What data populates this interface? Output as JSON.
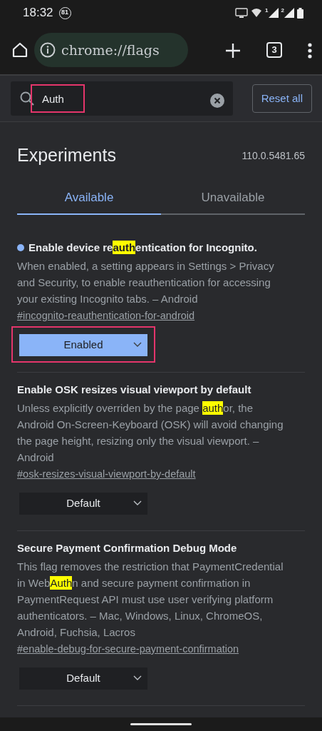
{
  "status_bar": {
    "time": "18:32",
    "notification_count": "81",
    "sim_labels": [
      "1",
      "2"
    ]
  },
  "toolbar": {
    "url": "chrome://flags",
    "tab_count": "3"
  },
  "search": {
    "value": "Auth",
    "annotated": true,
    "reset_label": "Reset all"
  },
  "header": {
    "title": "Experiments",
    "version": "110.0.5481.65"
  },
  "tabs": [
    {
      "label": "Available",
      "selected": true
    },
    {
      "label": "Unavailable",
      "selected": false
    }
  ],
  "flags": [
    {
      "modified": true,
      "annotated": true,
      "title": [
        {
          "text": "Enable device re",
          "match": false
        },
        {
          "text": "auth",
          "match": true
        },
        {
          "text": "entication for Incognito.",
          "match": false
        }
      ],
      "description": [
        {
          "text": "When enabled, a setting appears in Settings > Privacy and Security, to enable reauthentication for accessing your existing Incognito tabs. – Android",
          "match": false
        }
      ],
      "link": "#incognito-reauthentication-for-android",
      "value": "Enabled"
    },
    {
      "modified": false,
      "annotated": false,
      "title": [
        {
          "text": "Enable OSK resizes visual viewport by default",
          "match": false
        }
      ],
      "description": [
        {
          "text": "Unless explicitly overriden by the page ",
          "match": false
        },
        {
          "text": "auth",
          "match": true
        },
        {
          "text": "or, the Android On-Screen-Keyboard (OSK) will avoid changing the page height, resizing only the visual viewport. – Android",
          "match": false
        }
      ],
      "link": "#osk-resizes-visual-viewport-by-default",
      "value": "Default"
    },
    {
      "modified": false,
      "annotated": false,
      "title": [
        {
          "text": "Secure Payment Confirmation Debug Mode",
          "match": false
        }
      ],
      "description": [
        {
          "text": "This flag removes the restriction that PaymentCredential in Web",
          "match": false
        },
        {
          "text": "Auth",
          "match": true
        },
        {
          "text": "n and secure payment confirmation in PaymentRequest API must use user verifying platform authenticators. – Mac, Windows, Linux, ChromeOS, Android, Fuchsia, Lacros",
          "match": false
        }
      ],
      "link": "#enable-debug-for-secure-payment-confirmation",
      "value": "Default"
    }
  ]
}
